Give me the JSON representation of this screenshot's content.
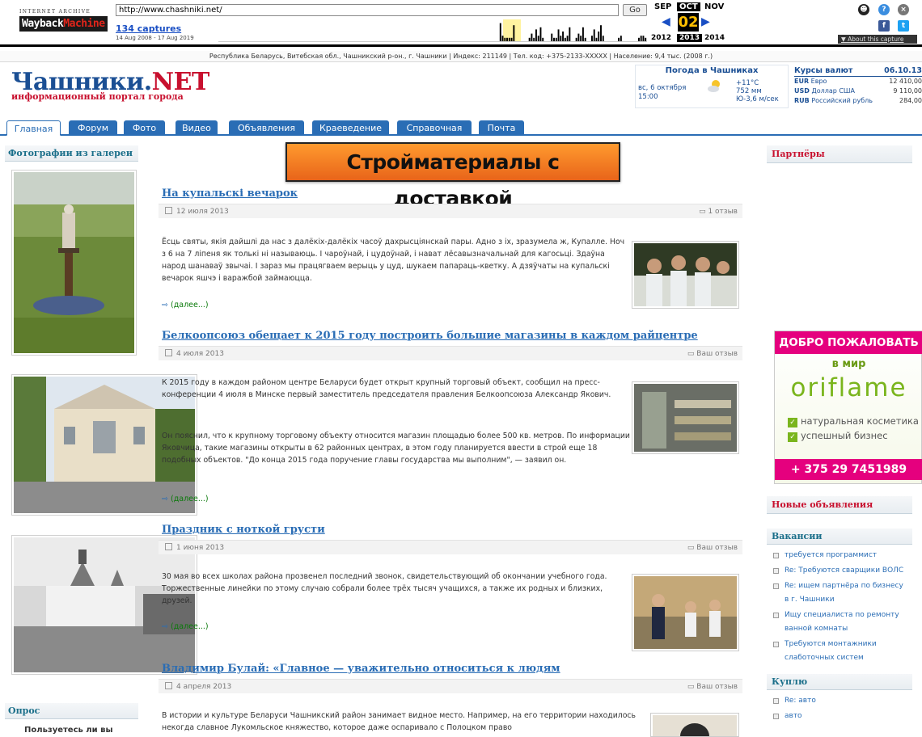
{
  "wayback": {
    "logo_top": "INTERNET ARCHIVE",
    "logo_main_a": "Wayback",
    "logo_main_b": "Machine",
    "url": "http://www.chashniki.net/",
    "go": "Go",
    "captures": "134 captures",
    "range": "14 Aug 2008 - 17 Aug 2019",
    "months": [
      "SEP",
      "OCT",
      "NOV"
    ],
    "day": "02",
    "years": [
      "2012",
      "2013",
      "2014"
    ],
    "about": "▼ About this capture",
    "sparkline": [
      0,
      0,
      0,
      0,
      0,
      0,
      0,
      0,
      0,
      0,
      0,
      0,
      0,
      0,
      0,
      0,
      0,
      0,
      0,
      0,
      0,
      0,
      0,
      0,
      0,
      0,
      0,
      0,
      0,
      0,
      0,
      0,
      0,
      0,
      0,
      0,
      0,
      0,
      0,
      0,
      0,
      0,
      0,
      0,
      0,
      0,
      0,
      0,
      0,
      0,
      0,
      0,
      0,
      0,
      0,
      0,
      0,
      0,
      0,
      0,
      0,
      0,
      0,
      0,
      0,
      0,
      0,
      0,
      0,
      0,
      0,
      0,
      0,
      0,
      0,
      0,
      0,
      0,
      0,
      0,
      0,
      0,
      0,
      0,
      0,
      0,
      0,
      0,
      0,
      0,
      0,
      0,
      0,
      0,
      0,
      0,
      0,
      0,
      0,
      0,
      0,
      0,
      0,
      0,
      0,
      0,
      0,
      0,
      0,
      0,
      0,
      0,
      0,
      0,
      0,
      0,
      0,
      0,
      0,
      0,
      0,
      0,
      0,
      0,
      0,
      0,
      9,
      3,
      2,
      2,
      2,
      2,
      8,
      0,
      0,
      0,
      0,
      0,
      0,
      2,
      4,
      2,
      6,
      3,
      7,
      2,
      0,
      0,
      0,
      4,
      2,
      2,
      6,
      3,
      5,
      2,
      3,
      7,
      0,
      0,
      2,
      4,
      3,
      7,
      2,
      0,
      0,
      3,
      6,
      2,
      5,
      8,
      3,
      0,
      0,
      0,
      0,
      0,
      0,
      2,
      3,
      0,
      0,
      0,
      0,
      0,
      0,
      0,
      2,
      3,
      3,
      2
    ]
  },
  "infobar": "Республика Беларусь, Витебская обл., Чашникский р-он., г. Чашники | Индекс: 211149 | Тел. код: +375-2133-XXXXX | Население: 9,4 тыс. (2008 г.)",
  "logo": {
    "title_a": "Чашники.",
    "title_b": "NET",
    "subtitle": "информационный портал города"
  },
  "weather": {
    "header": "Погода в Чашниках",
    "date": "вс, 6 октября",
    "time": "15:00",
    "temp": "+11°C",
    "pressure": "752 мм",
    "wind": "Ю-3,6 м/сек"
  },
  "rates": {
    "header": "Курсы валют",
    "date": "06.10.13",
    "rows": [
      {
        "code": "EUR",
        "name": "Евро",
        "value": "12 410,00"
      },
      {
        "code": "USD",
        "name": "Доллар США",
        "value": "9 110,00"
      },
      {
        "code": "RUB",
        "name": "Российский рубль",
        "value": "284,00"
      }
    ]
  },
  "nav": [
    "Главная",
    "Форум",
    "Фото",
    "Видео",
    "Объявления",
    "Краеведение",
    "Справочная",
    "Почта"
  ],
  "left": {
    "gallery_title": "Фотографии из галереи",
    "poll_title": "Опрос",
    "poll_question": "Пользуетесь ли вы"
  },
  "banner": "Стройматериалы с доставкой",
  "articles": [
    {
      "title": "На купальскі вечарок",
      "date": "12 июля 2013",
      "comments": "1 отзыв",
      "body": "Ёсць святы, якія дайшлі да нас з далёкіх-далёкіх часоў дахрысціянскай пары. Адно з іх, зразумела ж, Купалле. Ноч з 6 на 7 ліпеня як толькі ні называюць. І чароўнай, і цудоўнай, і нават лёсавызначальнай для кагосьці. Здаўна народ шанаваў звычаі. І зараз мы працягваем верыць у цуд, шукаем папараць-кветку. А дзяўчаты на купальскі вечарок яшчэ і варажбой займаюцца.",
      "more": "(далее...)"
    },
    {
      "title": "Белкоопсоюз обещает к 2015 году построить большие магазины в каждом райцентре",
      "date": "4 июля 2013",
      "comments": "Ваш отзыв",
      "body": "К 2015 году в каждом районом центре Беларуси будет открыт крупный торговый объект, сообщил на пресс-конференции 4 июля в Минске первый заместитель председателя правления Белкоопсоюза Александр Якович.",
      "body2": "Он пояснил, что к крупному торговому объекту относится магазин площадью более 500 кв. метров. По информации Яковчица, такие магазины открыты в 62 районных центрах, в этом году планируется ввести в строй еще 18 подобных объектов. \"До конца 2015 года поручение главы государства мы выполним\", — заявил он.",
      "more": "(далее...)"
    },
    {
      "title": "Праздник с ноткой грусти",
      "date": "1 июня 2013",
      "comments": "Ваш отзыв",
      "body": "30 мая во всех школах района прозвенел последний звонок, свидетельствующий об окончании учебного года. Торжественные линейки по этому случаю собрали более трёх тысяч учащихся, а также их родных и близких, друзей.",
      "more": "(далее...)"
    },
    {
      "title": "Владимир Булай: «Главное — уважительно относиться к людям",
      "date": "4 апреля 2013",
      "comments": "Ваш отзыв",
      "body": "В истории и культуре Беларуси Чашникский район занимает видное место. Например, на его территории находилось некогда славное Лукомльское княжество, которое даже оспаривало с Полоцком право"
    }
  ],
  "right": {
    "partners": "Партнёры",
    "ori": {
      "top": "ДОБРО ПОЖАЛОВАТЬ",
      "world": "в мир",
      "brand": "oriflame",
      "b1": "натуральная косметика",
      "b2": "успешный бизнес",
      "phone": "+ 375 29 7451989"
    },
    "new_ads": "Новые объявления",
    "vacancies": "Вакансии",
    "vacancy_items": [
      "требуется программист",
      "Re: Требуются сварщики ВОЛС",
      "Re: ищем партнёра по бизнесу в г. Чашники",
      "Ищу специалиста по ремонту ванной комнаты",
      "Требуются монтажники слаботочных систем"
    ],
    "buy": "Куплю",
    "buy_items": [
      "Re: авто",
      "авто"
    ]
  },
  "colors": {
    "accent": "#2a6db5",
    "brand_red": "#c8102e",
    "header_teal": "#1b6f8a"
  }
}
